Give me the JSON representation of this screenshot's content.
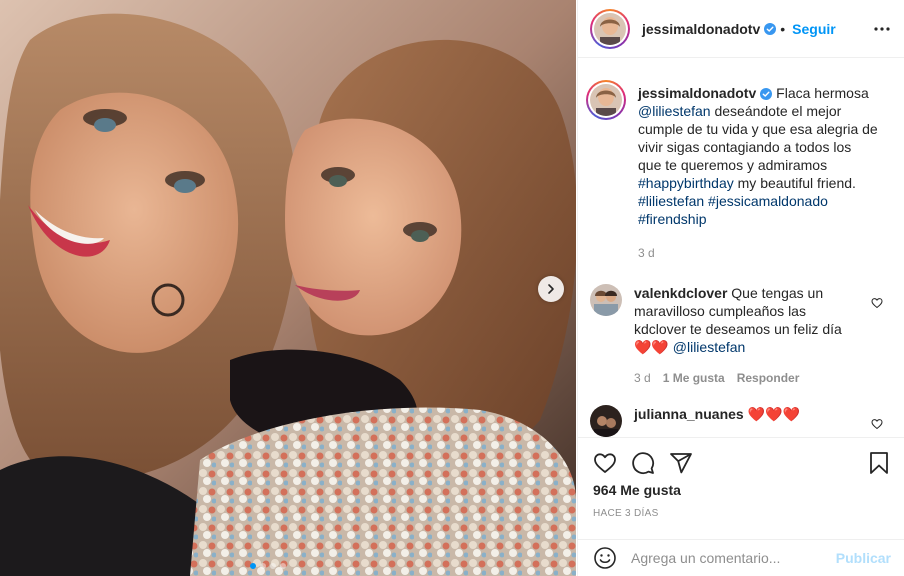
{
  "post": {
    "username": "jessimaldonadotv",
    "follow_label": "Seguir",
    "separator": "•",
    "caption_segments": [
      {
        "type": "text",
        "value": " Flaca hermosa "
      },
      {
        "type": "link",
        "value": "@liliestefan"
      },
      {
        "type": "text",
        "value": " deseándote el mejor cumple de tu vida y que esa alegria de vivir sigas contagiando a todos los que te queremos y admiramos "
      },
      {
        "type": "link",
        "value": "#happybirthday"
      },
      {
        "type": "text",
        "value": " my beautiful friend. "
      },
      {
        "type": "link",
        "value": "#liliestefan"
      },
      {
        "type": "text",
        "value": " "
      },
      {
        "type": "link",
        "value": "#jessicamaldonado"
      },
      {
        "type": "text",
        "value": " "
      },
      {
        "type": "link",
        "value": "#firendship"
      }
    ],
    "caption_time": "3 d",
    "likes": "964 Me gusta",
    "time_ago": "HACE 3 DÍAS"
  },
  "comments": [
    {
      "username": "valenkdclover",
      "text": " Que tengas un maravilloso cumpleaños las kdclover te deseamos un feliz día ❤️❤️ ",
      "mention": "@liliestefan",
      "time": "3 d",
      "likes": "1 Me gusta",
      "reply_label": "Responder"
    },
    {
      "username": "julianna_nuanes",
      "text": " ❤️❤️❤️"
    }
  ],
  "comment_input": {
    "placeholder": "Agrega un comentario...",
    "post_label": "Publicar"
  },
  "carousel": {
    "total": 4,
    "active": 0
  },
  "colors": {
    "accent": "#0095f6",
    "link": "#00376b",
    "muted": "#8e8e8e",
    "post_disabled": "#b2dffc",
    "verified": "#3897f0"
  },
  "icons": {
    "more": "ellipsis-icon",
    "like": "heart-icon",
    "comment": "comment-icon",
    "share": "paper-plane-icon",
    "save": "bookmark-icon",
    "emoji": "smiley-icon",
    "next": "chevron-right-icon",
    "verified": "verified-badge-icon"
  }
}
